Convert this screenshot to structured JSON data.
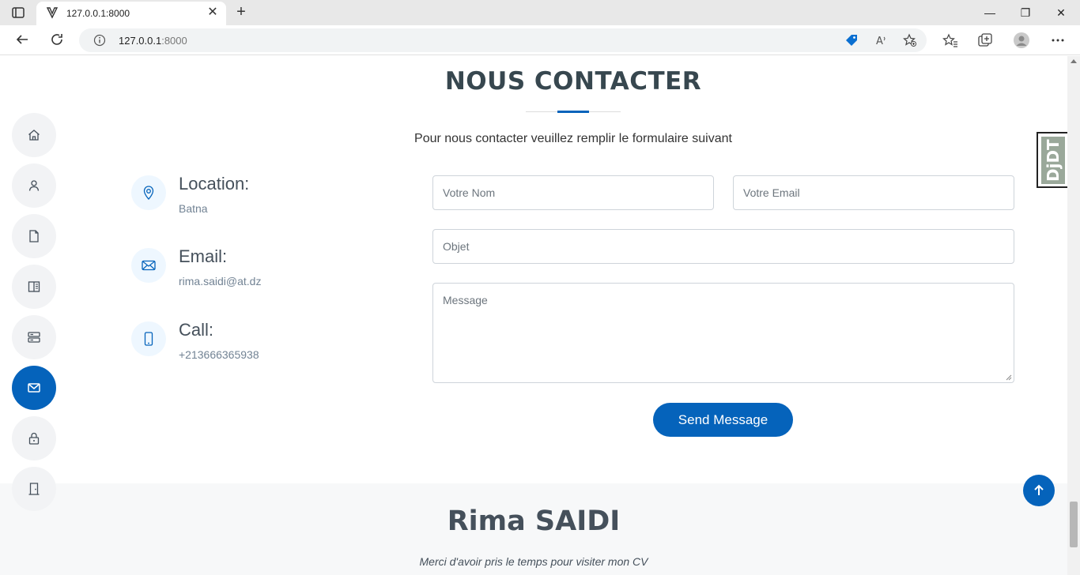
{
  "browser": {
    "tab_title": "127.0.0.1:8000",
    "url_host": "127.0.0.1",
    "url_port": ":8000"
  },
  "sidenav": {
    "items": [
      {
        "name": "home",
        "icon": "home-icon",
        "active": false
      },
      {
        "name": "about",
        "icon": "person-icon",
        "active": false
      },
      {
        "name": "resume",
        "icon": "file-icon",
        "active": false
      },
      {
        "name": "portfolio",
        "icon": "book-icon",
        "active": false
      },
      {
        "name": "services",
        "icon": "server-icon",
        "active": false
      },
      {
        "name": "contact",
        "icon": "envelope-icon",
        "active": true
      },
      {
        "name": "login",
        "icon": "lock-icon",
        "active": false
      },
      {
        "name": "logout",
        "icon": "door-icon",
        "active": false
      }
    ]
  },
  "contact": {
    "title": "NOUS CONTACTER",
    "subtitle": "Pour nous contacter veuillez remplir le formulaire suivant",
    "location_label": "Location:",
    "location_value": "Batna",
    "email_label": "Email:",
    "email_value": "rima.saidi@at.dz",
    "call_label": "Call:",
    "call_value": "+213666365938",
    "form": {
      "name_placeholder": "Votre Nom",
      "email_placeholder": "Votre Email",
      "subject_placeholder": "Objet",
      "message_placeholder": "Message",
      "send_label": "Send Message"
    }
  },
  "footer": {
    "name": "Rima SAIDI",
    "text": "Merci d'avoir pris le temps pour visiter mon CV"
  },
  "debug_toolbar": {
    "label": "DjDT"
  },
  "colors": {
    "accent": "#0563bb",
    "heading": "#37474f"
  }
}
